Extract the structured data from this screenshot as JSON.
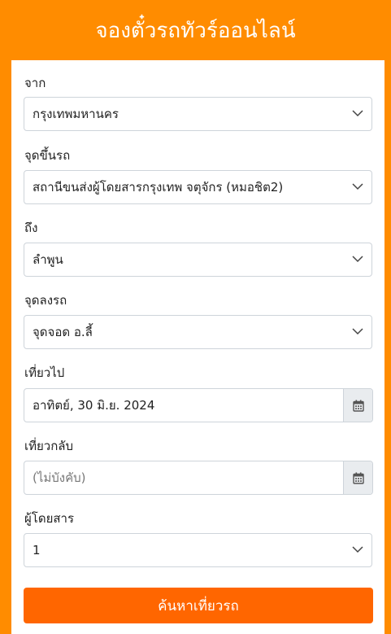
{
  "header": {
    "title": "จองตั๋วรถทัวร์ออนไลน์"
  },
  "form": {
    "from": {
      "label": "จาก",
      "value": "กรุงเทพมหานคร"
    },
    "pickup": {
      "label": "จุดขึ้นรถ",
      "value": "สถานีขนส่งผู้โดยสารกรุงเทพ จตุจักร (หมอชิต2)"
    },
    "to": {
      "label": "ถึง",
      "value": "ลำพูน"
    },
    "dropoff": {
      "label": "จุดลงรถ",
      "value": "จุดจอด อ.ลี้"
    },
    "depart": {
      "label": "เที่ยวไป",
      "value": "อาทิตย์, 30 มิ.ย. 2024"
    },
    "return": {
      "label": "เที่ยวกลับ",
      "placeholder": "(ไม่บังคับ)"
    },
    "passengers": {
      "label": "ผู้โดยสาร",
      "value": "1"
    },
    "search_button": "ค้นหาเที่ยวรถ"
  },
  "icons": {
    "select_arrow": "chevron-down-icon",
    "date_picker": "calendar-icon"
  },
  "colors": {
    "brand_orange": "#ff8c00",
    "button_orange": "#ff6600"
  }
}
